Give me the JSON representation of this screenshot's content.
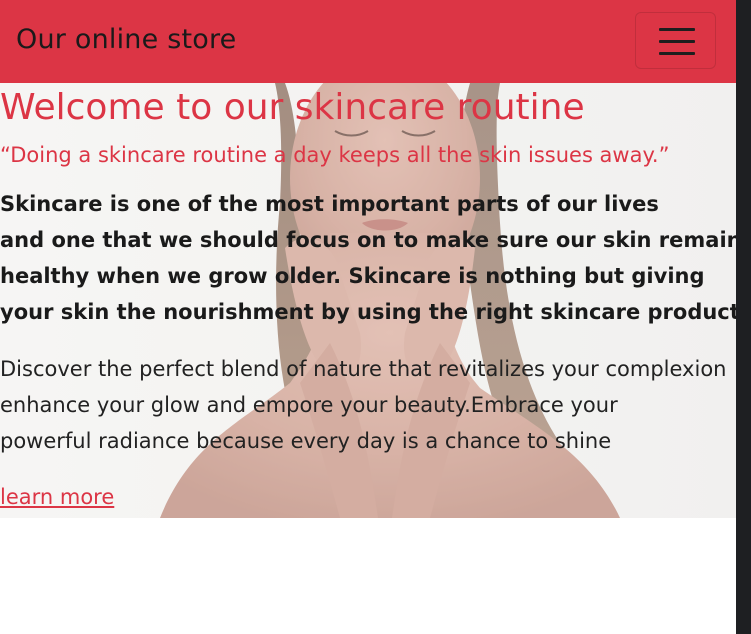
{
  "navbar": {
    "brand": "Our online store",
    "toggler_icon": "hamburger-menu-icon"
  },
  "hero": {
    "image_icon": "woman-skincare-photo",
    "title": "Welcome to our skincare routine",
    "quote": "“Doing a skincare routine a day keeps all the skin issues away.”",
    "bold_lines": [
      "Skincare is one of the most important parts of our lives",
      "and one that we should focus on to make sure our skin remains",
      "healthy when we grow older. Skincare is nothing but giving",
      "your skin the nourishment by using the right skincare products."
    ],
    "body_lines": [
      "Discover the perfect blend of nature that revitalizes your complexion",
      "enhance your glow and empore your beauty.Embrace your",
      "powerful radiance because every day is a chance to shine"
    ],
    "link_label": "learn more"
  },
  "colors": {
    "brand_red": "#dc3545",
    "text_dark": "#1a1a1a",
    "hero_bg": "#f1f0ee"
  }
}
